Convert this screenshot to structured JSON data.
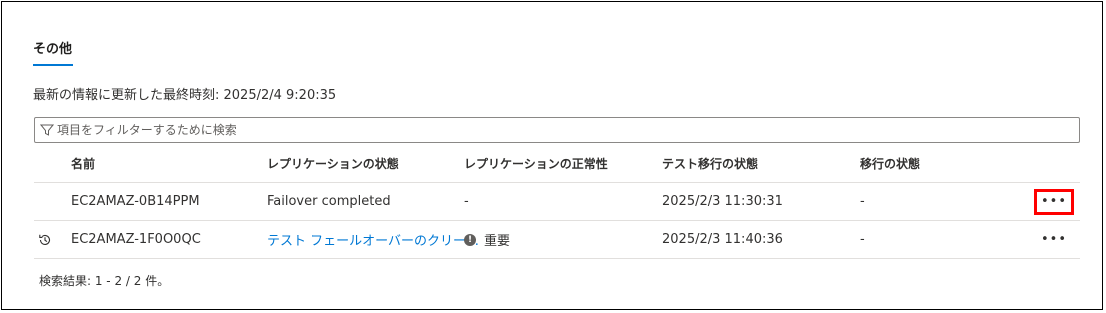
{
  "section": {
    "title": "その他",
    "last_updated": "最新の情報に更新した最終時刻: 2025/2/4 9:20:35"
  },
  "filter": {
    "placeholder": "項目をフィルターするために検索",
    "icon": "filter-icon"
  },
  "table": {
    "headers": {
      "name": "名前",
      "replication_status": "レプリケーションの状態",
      "replication_health": "レプリケーションの正常性",
      "test_migration_status": "テスト移行の状態",
      "migration_status": "移行の状態"
    },
    "rows": [
      {
        "icon": "",
        "name": "EC2AMAZ-0B14PPM",
        "replication_status": "Failover completed",
        "replication_health": "-",
        "test_migration_status": "2025/2/3 11:30:31",
        "migration_status": "-",
        "more": "•••",
        "more_highlighted": true
      },
      {
        "icon": "history-icon",
        "name": "EC2AMAZ-1F0O0QC",
        "replication_status": "テスト フェールオーバーのクリー…",
        "replication_health_icon": "!",
        "replication_health": "重要",
        "test_migration_status": "2025/2/3 11:40:36",
        "migration_status": "-",
        "more": "•••",
        "more_highlighted": false
      }
    ]
  },
  "results": "検索結果: 1 - 2 / 2 件。",
  "colors": {
    "accent": "#0078d4",
    "highlight": "#ff0000",
    "border": "#e1dfdd"
  }
}
